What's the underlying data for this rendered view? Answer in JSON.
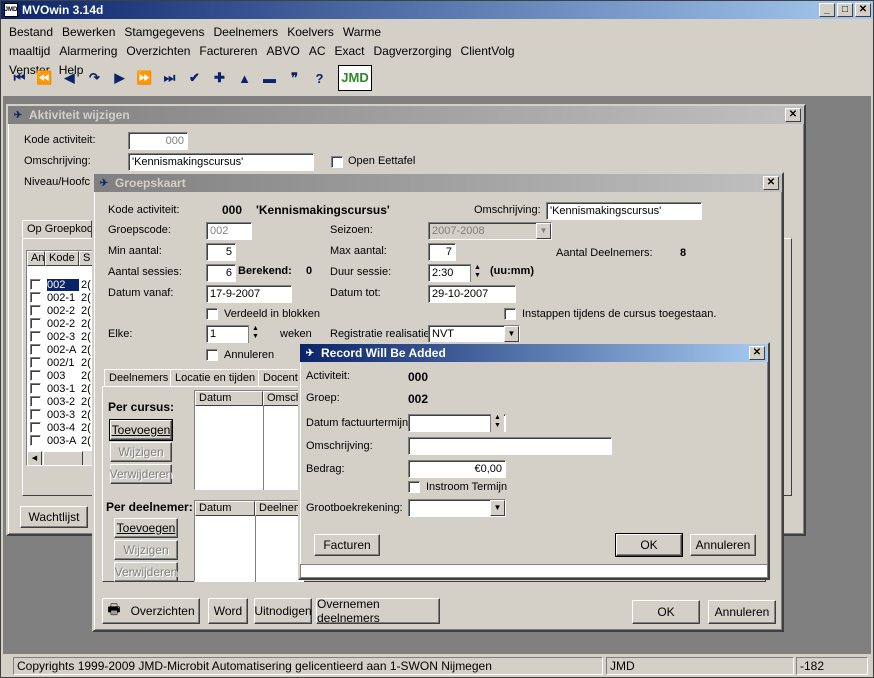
{
  "app": {
    "title": "MVOwin 3.14d",
    "logo": "JMD",
    "minimize": "_",
    "maximize": "□",
    "close": "✕"
  },
  "menu": [
    "Bestand",
    "Bewerken",
    "Stamgegevens",
    "Deelnemers",
    "Koelvers",
    "Warme maaltijd",
    "Alarmering",
    "Overzichten",
    "Factureren",
    "ABVO",
    "AC",
    "Exact",
    "Dagverzorging",
    "ClientVolg",
    "Venster",
    "Help"
  ],
  "toolbar": {
    "icons": [
      "⏮",
      "⏪",
      "◀",
      "↷",
      "▶",
      "⏩",
      "⏭",
      "✔",
      "✚",
      "▲",
      "▬",
      "❞",
      "?"
    ],
    "logo": "JMD"
  },
  "aw": {
    "title": "Aktiviteit wijzigen",
    "kode_label": "Kode activiteit:",
    "kode": "000",
    "omschr_label": "Omschrijving:",
    "omschr": "'Kennismakingscursus'",
    "open_eettafel": "Open Eettafel",
    "niveau_label": "Niveau/Hoofc",
    "tab": "Op Groepkoc",
    "grid_headers": [
      "An",
      "Kode",
      "S"
    ],
    "rows": [
      "002",
      "002-1",
      "002-2",
      "002-2",
      "002-3",
      "002-A",
      "002/1",
      "003",
      "003-1",
      "003-2",
      "003-3",
      "003-4",
      "003-A"
    ],
    "row_suffix": "2(",
    "wachtlijst": "Wachtlijst"
  },
  "gk": {
    "title": "Groepskaart",
    "kode_label": "Kode activiteit:",
    "kode": "000",
    "naam": "'Kennismakingscursus'",
    "omschr_label": "Omschrijving:",
    "omschr": "'Kennismakingscursus'",
    "groepscode_label": "Groepscode:",
    "groepscode": "002",
    "seizoen_label": "Seizoen:",
    "seizoen": "2007-2008",
    "min_label": "Min aantal:",
    "min": "5",
    "max_label": "Max aantal:",
    "max": "7",
    "aantal_deelnemers_label": "Aantal Deelnemers:",
    "aantal_deelnemers": "8",
    "sessies_label": "Aantal sessies:",
    "sessies": "6",
    "berekend_label": "Berekend:",
    "berekend": "0",
    "duur_label": "Duur sessie:",
    "duur": "2:30",
    "duur_unit": "(uu:mm)",
    "vanaf_label": "Datum vanaf:",
    "vanaf": "17-9-2007",
    "tot_label": "Datum tot:",
    "tot": "29-10-2007",
    "verdeeld": "Verdeeld in blokken",
    "instappen": "Instappen tijdens de cursus toegestaan.",
    "elke_label": "Elke:",
    "elke": "1",
    "weken": "weken",
    "registratie_label": "Registratie realisatie:",
    "registratie": "NVT",
    "annuleren_chk": "Annuleren",
    "tabs": [
      "Deelnemers",
      "Locatie en tijden",
      "Docent"
    ],
    "per_cursus": "Per cursus:",
    "per_deelnemer": "Per deelnemer:",
    "toevoegen": "Toevoegen",
    "wijzigen": "Wijzigen",
    "verwijderen": "Verwijderen",
    "col_datum": "Datum",
    "col_omsch": "Omsch",
    "col_deelnemer": "Deelnem",
    "overzichten": "Overzichten",
    "word": "Word",
    "uitnodigen": "Uitnodigen",
    "overnemen": "Overnemen deelnemers",
    "ok": "OK",
    "annuleren": "Annuleren"
  },
  "rw": {
    "title": "Record Will Be Added",
    "activiteit_label": "Activiteit:",
    "activiteit": "000",
    "groep_label": "Groep:",
    "groep": "002",
    "datum_label": "Datum factuurtermijn:",
    "datum": "",
    "omschr_label": "Omschrijving:",
    "omschr": "",
    "bedrag_label": "Bedrag:",
    "bedrag": "€0,00",
    "instroom": "Instroom Termijn",
    "grootboek_label": "Grootboekrekening:",
    "grootboek": "",
    "facturen": "Facturen",
    "ok": "OK",
    "annuleren": "Annuleren"
  },
  "status": {
    "copyright": "Copyrights 1999-2009 JMD-Microbit Automatisering gelicentieerd aan 1-SWON Nijmegen",
    "user": "JMD",
    "code": "-182"
  }
}
